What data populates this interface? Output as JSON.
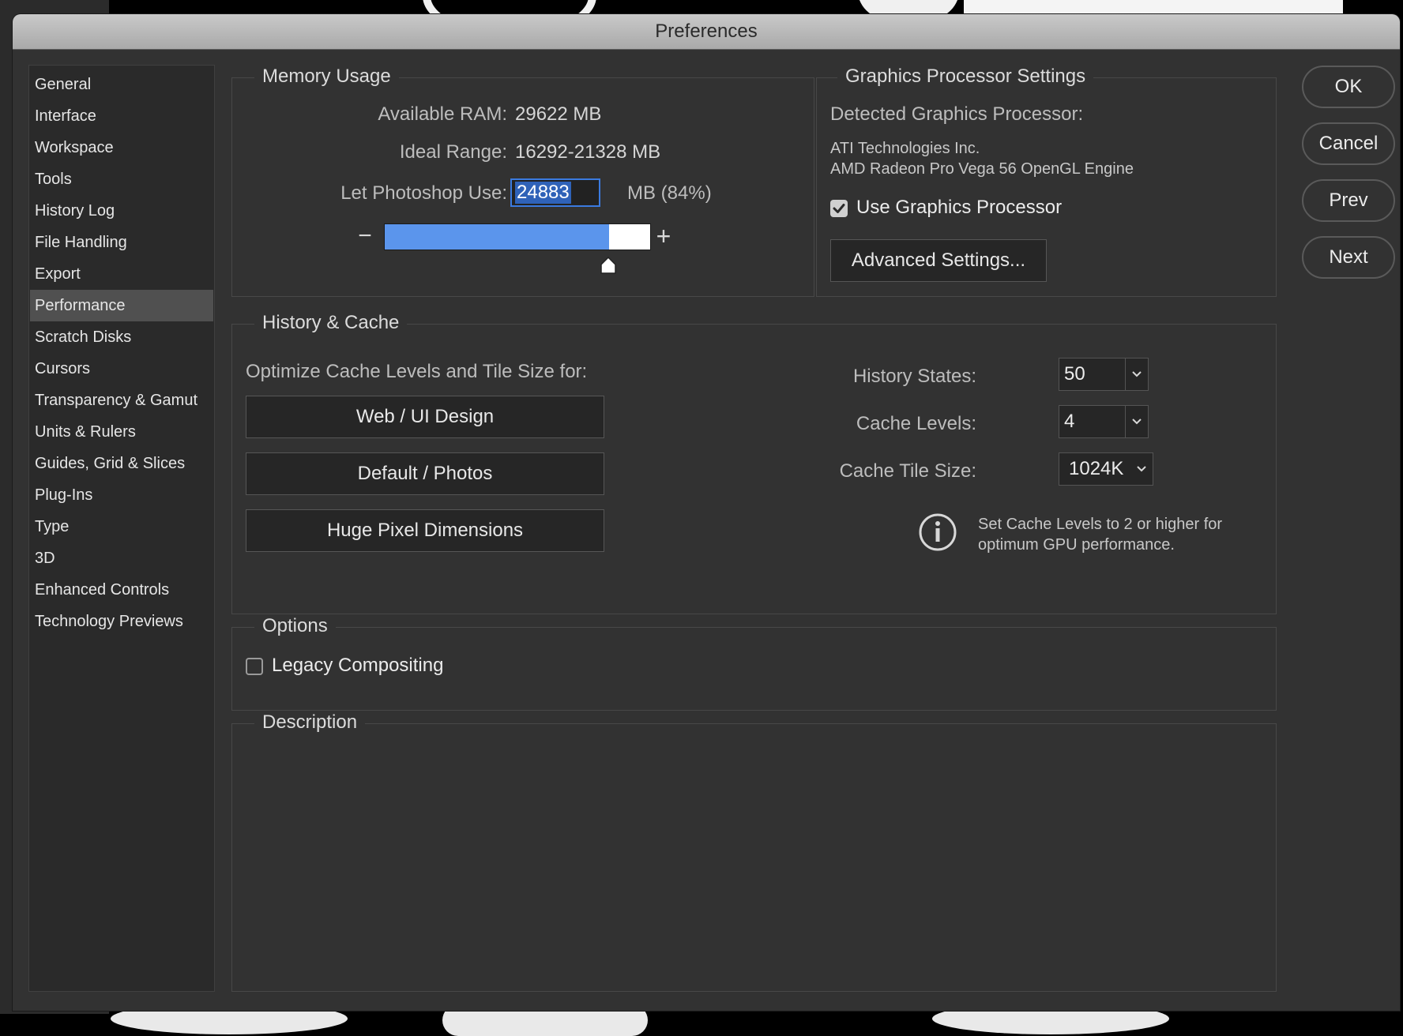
{
  "window": {
    "title": "Preferences"
  },
  "sidebar": {
    "items": [
      {
        "label": "General"
      },
      {
        "label": "Interface"
      },
      {
        "label": "Workspace"
      },
      {
        "label": "Tools"
      },
      {
        "label": "History Log"
      },
      {
        "label": "File Handling"
      },
      {
        "label": "Export"
      },
      {
        "label": "Performance",
        "selected": true
      },
      {
        "label": "Scratch Disks"
      },
      {
        "label": "Cursors"
      },
      {
        "label": "Transparency & Gamut"
      },
      {
        "label": "Units & Rulers"
      },
      {
        "label": "Guides, Grid & Slices"
      },
      {
        "label": "Plug-Ins"
      },
      {
        "label": "Type"
      },
      {
        "label": "3D"
      },
      {
        "label": "Enhanced Controls"
      },
      {
        "label": "Technology Previews"
      }
    ]
  },
  "memory_usage": {
    "title": "Memory Usage",
    "available_ram_label": "Available RAM:",
    "available_ram_value": "29622 MB",
    "ideal_range_label": "Ideal Range:",
    "ideal_range_value": "16292-21328 MB",
    "let_use_label": "Let Photoshop Use:",
    "let_use_value": "24883",
    "let_use_suffix": "MB (84%)",
    "slider_fraction": 0.84
  },
  "gpu": {
    "title": "Graphics Processor Settings",
    "detected_label": "Detected Graphics Processor:",
    "vendor": "ATI Technologies Inc.",
    "model": "AMD Radeon Pro Vega 56 OpenGL Engine",
    "use_gpu_label": "Use Graphics Processor",
    "use_gpu_checked": true,
    "advanced_button": "Advanced Settings..."
  },
  "history_cache": {
    "title": "History & Cache",
    "optimize_label": "Optimize Cache Levels and Tile Size for:",
    "presets": [
      "Web / UI Design",
      "Default / Photos",
      "Huge Pixel Dimensions"
    ],
    "history_states_label": "History States:",
    "history_states_value": "50",
    "cache_levels_label": "Cache Levels:",
    "cache_levels_value": "4",
    "cache_tile_label": "Cache Tile Size:",
    "cache_tile_value": "1024K",
    "info_line1": "Set Cache Levels to 2 or higher for",
    "info_line2": "optimum GPU performance."
  },
  "options": {
    "title": "Options",
    "legacy_compositing_label": "Legacy Compositing",
    "legacy_compositing_checked": false
  },
  "description": {
    "title": "Description"
  },
  "actions": {
    "ok": "OK",
    "cancel": "Cancel",
    "prev": "Prev",
    "next": "Next"
  },
  "colors": {
    "accent": "#5b95ec",
    "selection": "#2f62b8",
    "window_bg": "#323232"
  }
}
